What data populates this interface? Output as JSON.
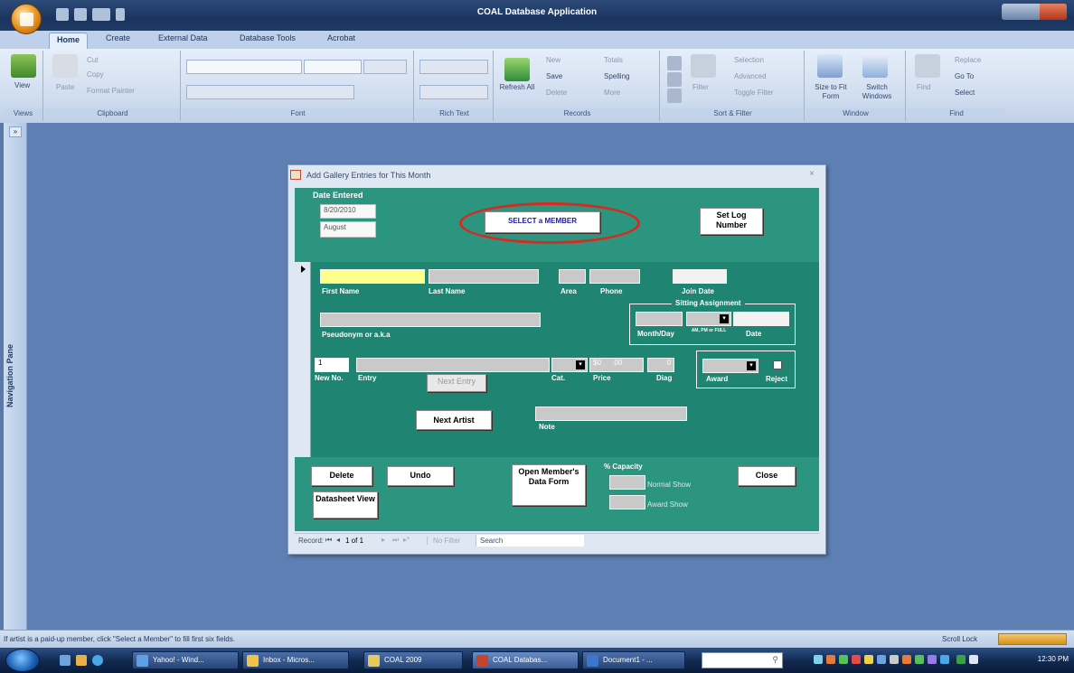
{
  "window": {
    "title": "COAL Database Application"
  },
  "ribbon_tabs": [
    "Home",
    "Create",
    "External Data",
    "Database Tools",
    "Acrobat"
  ],
  "ribbon": {
    "views": {
      "view": "View",
      "label": "Views"
    },
    "clipboard": {
      "paste": "Paste",
      "cut": "Cut",
      "copy": "Copy",
      "format_painter": "Format Painter",
      "label": "Clipboard"
    },
    "font": {
      "label": "Font"
    },
    "rich_text": {
      "label": "Rich Text"
    },
    "records": {
      "refresh": "Refresh All",
      "new": "New",
      "save": "Save",
      "delete": "Delete",
      "totals": "Totals",
      "spelling": "Spelling",
      "more": "More",
      "label": "Records"
    },
    "sort_filter": {
      "filter": "Filter",
      "selection": "Selection",
      "advanced": "Advanced",
      "toggle_filter": "Toggle Filter",
      "label": "Sort & Filter"
    },
    "window": {
      "size_to_fit": "Size to Fit Form",
      "switch_windows": "Switch Windows",
      "label": "Window"
    },
    "find": {
      "find": "Find",
      "replace": "Replace",
      "go_to": "Go To",
      "select": "Select",
      "label": "Find"
    }
  },
  "nav_pane": {
    "label": "Navigation Pane",
    "shutter": "»"
  },
  "form": {
    "title": "Add Gallery Entries for This Month",
    "header": {
      "date_entered_label": "Date Entered",
      "date_value": "8/20/2010",
      "month_value": "August",
      "select_member": "SELECT a MEMBER",
      "set_log_number": "Set Log Number"
    },
    "detail": {
      "first_name": "First Name",
      "last_name": "Last Name",
      "area": "Area",
      "phone": "Phone",
      "join_date": "Join Date",
      "sitting_assignment": "Sitting Assignment",
      "month_day": "Month/Day",
      "am_pm_full": "AM, PM or FULL",
      "date": "Date",
      "pseudonym": "Pseudonym or a.k.a",
      "new_no_value": "1",
      "new_no": "New No.",
      "entry": "Entry",
      "cat": "Cat.",
      "price": "Price",
      "price_value": "$0",
      "price_cents": ".00",
      "diag": "Diag",
      "diag_value": "0",
      "award": "Award",
      "reject": "Reject",
      "next_entry": "Next Entry",
      "next_artist": "Next Artist",
      "note": "Note"
    },
    "footer": {
      "delete": "Delete",
      "undo": "Undo",
      "datasheet_view": "Datasheet View",
      "open_member": "Open Member's Data Form",
      "capacity": "% Capacity",
      "normal_show": "Normal Show",
      "award_show": "Award Show",
      "close": "Close"
    },
    "record_nav": {
      "record": "Record:",
      "position": "1 of 1",
      "no_filter": "No Filter",
      "search": "Search"
    }
  },
  "status": {
    "message": "If artist is a paid-up member, click \"Select a Member\" to fill first six fields.",
    "scroll_lock": "Scroll Lock"
  },
  "taskbar": {
    "items": [
      "Yahoo! - Wind...",
      "Inbox - Micros...",
      "COAL 2009",
      "COAL Databas...",
      "Document1 - ..."
    ],
    "clock": "12:30 PM"
  }
}
